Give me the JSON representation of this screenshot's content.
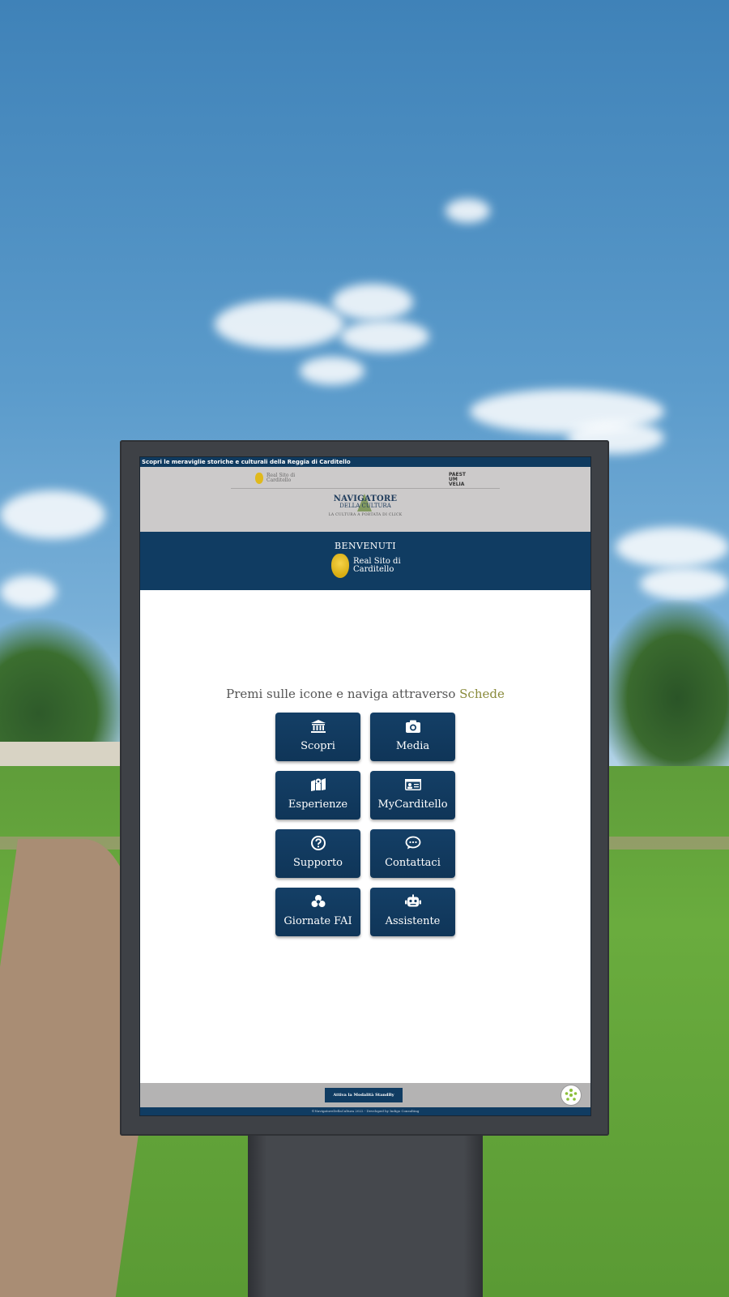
{
  "page": {
    "background_colors": {
      "sky": "#5b9bcb",
      "grass": "#6aac3e",
      "kiosk": "#3e4146"
    }
  },
  "screen": {
    "ticker_text": "Scopri le meraviglie storiche e culturali della Reggia di Carditello",
    "partners": {
      "real_sito_small_line1": "Real Sito di",
      "real_sito_small_line2": "Carditello",
      "paestum_line1": "PAEST",
      "paestum_line2": "UM",
      "paestum_line3": "VELIA"
    },
    "navigatore_logo": {
      "title": "NAVIGATORE",
      "subtitle": "DELLA CULTURA",
      "tagline": "LA CULTURA A PORTATA DI CLICK"
    },
    "welcome": {
      "title": "BENVENUTI",
      "site_line1": "Real Sito di",
      "site_line2": "Carditello"
    },
    "prompt": {
      "text": "Premi sulle icone e naviga attraverso ",
      "highlight": "Schede"
    },
    "tiles": [
      {
        "label": "Scopri",
        "icon": "museum-icon"
      },
      {
        "label": "Media",
        "icon": "camera-icon"
      },
      {
        "label": "Esperienze",
        "icon": "map-pin-icon"
      },
      {
        "label": "MyCarditello",
        "icon": "id-card-icon"
      },
      {
        "label": "Supporto",
        "icon": "question-circle-icon"
      },
      {
        "label": "Contattaci",
        "icon": "chat-bubble-icon"
      },
      {
        "label": "Giornate FAI",
        "icon": "fai-logo-icon"
      },
      {
        "label": "Assistente",
        "icon": "robot-icon"
      }
    ],
    "footer": {
      "standby_button": "Attiva la Modalità StandBy",
      "accessibility_icon": "accessibility-icon",
      "credits": "©NavigatoreDellaCultura 2022 - Developed by Indigo Consulting"
    }
  }
}
